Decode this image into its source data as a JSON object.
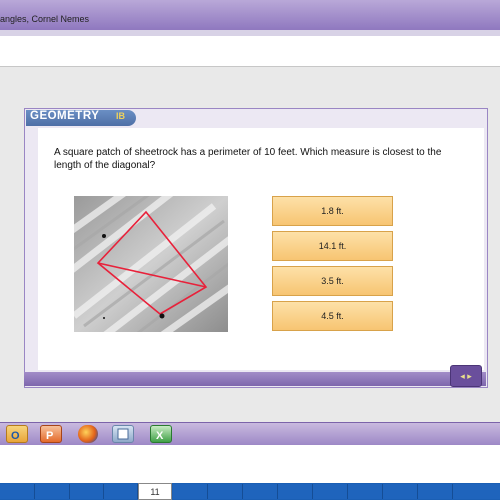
{
  "window": {
    "title_fragment": "angles, Cornel Nemes"
  },
  "slide": {
    "brand": "GEOMETRY",
    "brand_sub": "IB",
    "question": "A square patch of sheetrock has a perimeter of 10 feet. Which measure is closest to the length of the diagonal?",
    "answers": [
      "1.8 ft.",
      "14.1 ft.",
      "3.5 ft.",
      "4.5 ft."
    ],
    "nav_label": "◂ ▸"
  },
  "taskbar": {
    "icons": [
      "outlook-icon",
      "powerpoint-icon",
      "firefox-icon",
      "app-icon",
      "excel-icon"
    ]
  },
  "pager": {
    "current_page": "11"
  },
  "colors": {
    "accent_purple": "#8f78bf",
    "answer_fill": "#f7c572",
    "header_blue": "#4e6fa6",
    "pager_blue": "#1b5fb4"
  }
}
